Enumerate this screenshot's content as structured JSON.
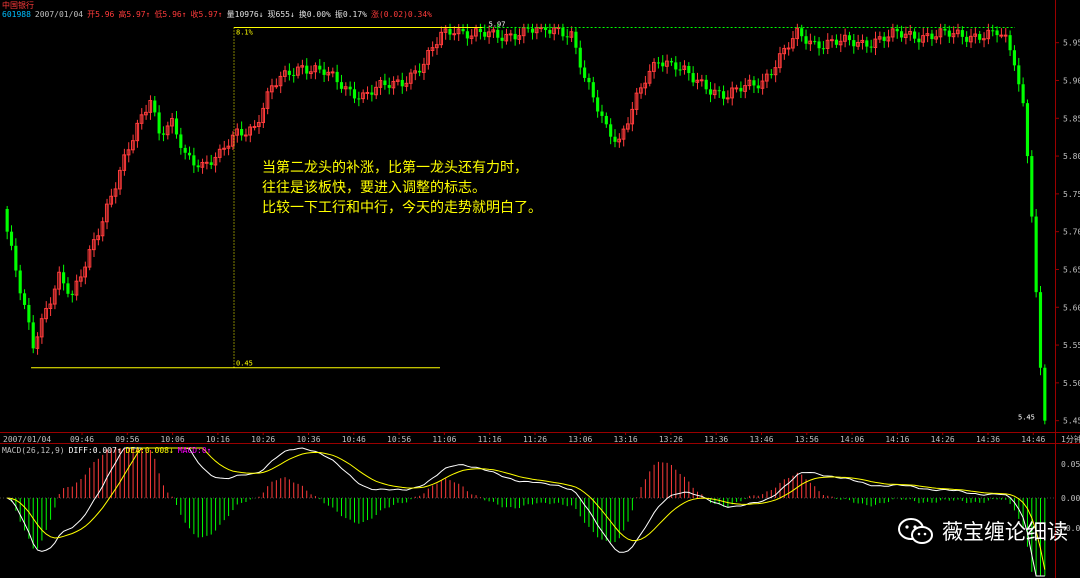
{
  "header": {
    "stock_name": "中国银行",
    "info_items": [
      {
        "text": "601988",
        "color": "#00bfff"
      },
      {
        "text": "2007/01/04",
        "color": "#c0c0c0"
      },
      {
        "text": "开5.96",
        "color": "#ff3b3b"
      },
      {
        "text": "高5.97↑",
        "color": "#ff3b3b"
      },
      {
        "text": "低5.96↑",
        "color": "#ff3b3b"
      },
      {
        "text": "收5.97↑",
        "color": "#ff3b3b"
      },
      {
        "text": "量10976↓",
        "color": "#e0e0e0"
      },
      {
        "text": "现655↓",
        "color": "#e0e0e0"
      },
      {
        "text": "换0.00%",
        "color": "#e0e0e0"
      },
      {
        "text": "振0.17%",
        "color": "#e0e0e0"
      },
      {
        "text": "涨(0.02)0.34%",
        "color": "#ff3b3b"
      }
    ]
  },
  "macd_header": [
    {
      "text": "MACD(26,12,9)",
      "color": "#c0c0c0"
    },
    {
      "text": "DIFF:0.007↑",
      "color": "#ffffff"
    },
    {
      "text": "DEA:0.008↓",
      "color": "#ffff00"
    },
    {
      "text": "MACD:0↑",
      "color": "#ff00ff"
    }
  ],
  "annotation": {
    "lines": [
      "当第二龙头的补涨，比第一龙头还有力时，",
      "往往是该板快，要进入调整的标志。",
      "比较一下工行和中行，今天的走势就明白了。"
    ]
  },
  "watermark": {
    "text": "薇宝缠论细读",
    "icon": "wechat-icon"
  },
  "colors": {
    "up": "#ff3b3b",
    "down": "#00ff00",
    "axis": "#9a0000",
    "label": "#c0c0c0",
    "marker": "#ffff00",
    "diff": "#ffffff",
    "dea": "#ffff00"
  },
  "chart_data": [
    {
      "type": "candlestick",
      "interval": "1分钟",
      "x_axis_label": "1分钟",
      "date": "2007/01/04",
      "xticks": [
        "2007/01/04",
        "09:46",
        "09:56",
        "10:06",
        "10:16",
        "10:26",
        "10:36",
        "10:46",
        "10:56",
        "11:06",
        "11:16",
        "11:26",
        "13:06",
        "13:16",
        "13:26",
        "13:36",
        "13:46",
        "13:56",
        "14:06",
        "14:16",
        "14:26",
        "14:36",
        "14:46"
      ],
      "yticks": [
        5.45,
        5.5,
        5.55,
        5.6,
        5.65,
        5.7,
        5.75,
        5.8,
        5.85,
        5.9,
        5.95
      ],
      "ylim": [
        5.435,
        5.98
      ],
      "marked_high": "5.97",
      "marked_low": "5.45",
      "range_markers": [
        "8.1%",
        "0.45"
      ],
      "anchors": [
        [
          0,
          5.7
        ],
        [
          3,
          5.62
        ],
        [
          6,
          5.55
        ],
        [
          9,
          5.6
        ],
        [
          12,
          5.64
        ],
        [
          15,
          5.61
        ],
        [
          20,
          5.69
        ],
        [
          25,
          5.76
        ],
        [
          30,
          5.84
        ],
        [
          33,
          5.88
        ],
        [
          35,
          5.83
        ],
        [
          38,
          5.84
        ],
        [
          41,
          5.8
        ],
        [
          45,
          5.79
        ],
        [
          49,
          5.8
        ],
        [
          53,
          5.83
        ],
        [
          57,
          5.84
        ],
        [
          61,
          5.89
        ],
        [
          65,
          5.91
        ],
        [
          68,
          5.92
        ],
        [
          73,
          5.91
        ],
        [
          78,
          5.89
        ],
        [
          82,
          5.88
        ],
        [
          86,
          5.89
        ],
        [
          91,
          5.9
        ],
        [
          96,
          5.92
        ],
        [
          100,
          5.96
        ],
        [
          103,
          5.97
        ],
        [
          107,
          5.96
        ],
        [
          114,
          5.96
        ],
        [
          127,
          5.97
        ],
        [
          130,
          5.96
        ],
        [
          133,
          5.9
        ],
        [
          138,
          5.84
        ],
        [
          141,
          5.82
        ],
        [
          144,
          5.86
        ],
        [
          147,
          5.9
        ],
        [
          150,
          5.93
        ],
        [
          154,
          5.92
        ],
        [
          158,
          5.9
        ],
        [
          162,
          5.89
        ],
        [
          166,
          5.88
        ],
        [
          170,
          5.89
        ],
        [
          174,
          5.9
        ],
        [
          178,
          5.93
        ],
        [
          182,
          5.96
        ],
        [
          186,
          5.95
        ],
        [
          191,
          5.95
        ],
        [
          197,
          5.95
        ],
        [
          205,
          5.96
        ],
        [
          230,
          5.96
        ],
        [
          232,
          5.92
        ],
        [
          234,
          5.87
        ],
        [
          235,
          5.8
        ],
        [
          236,
          5.72
        ],
        [
          237,
          5.62
        ],
        [
          238,
          5.52
        ],
        [
          239,
          5.45
        ]
      ]
    },
    {
      "type": "macd",
      "params": "MACD(26,12,9)",
      "diff": 0.007,
      "dea": 0.008,
      "macd": 0
    }
  ]
}
